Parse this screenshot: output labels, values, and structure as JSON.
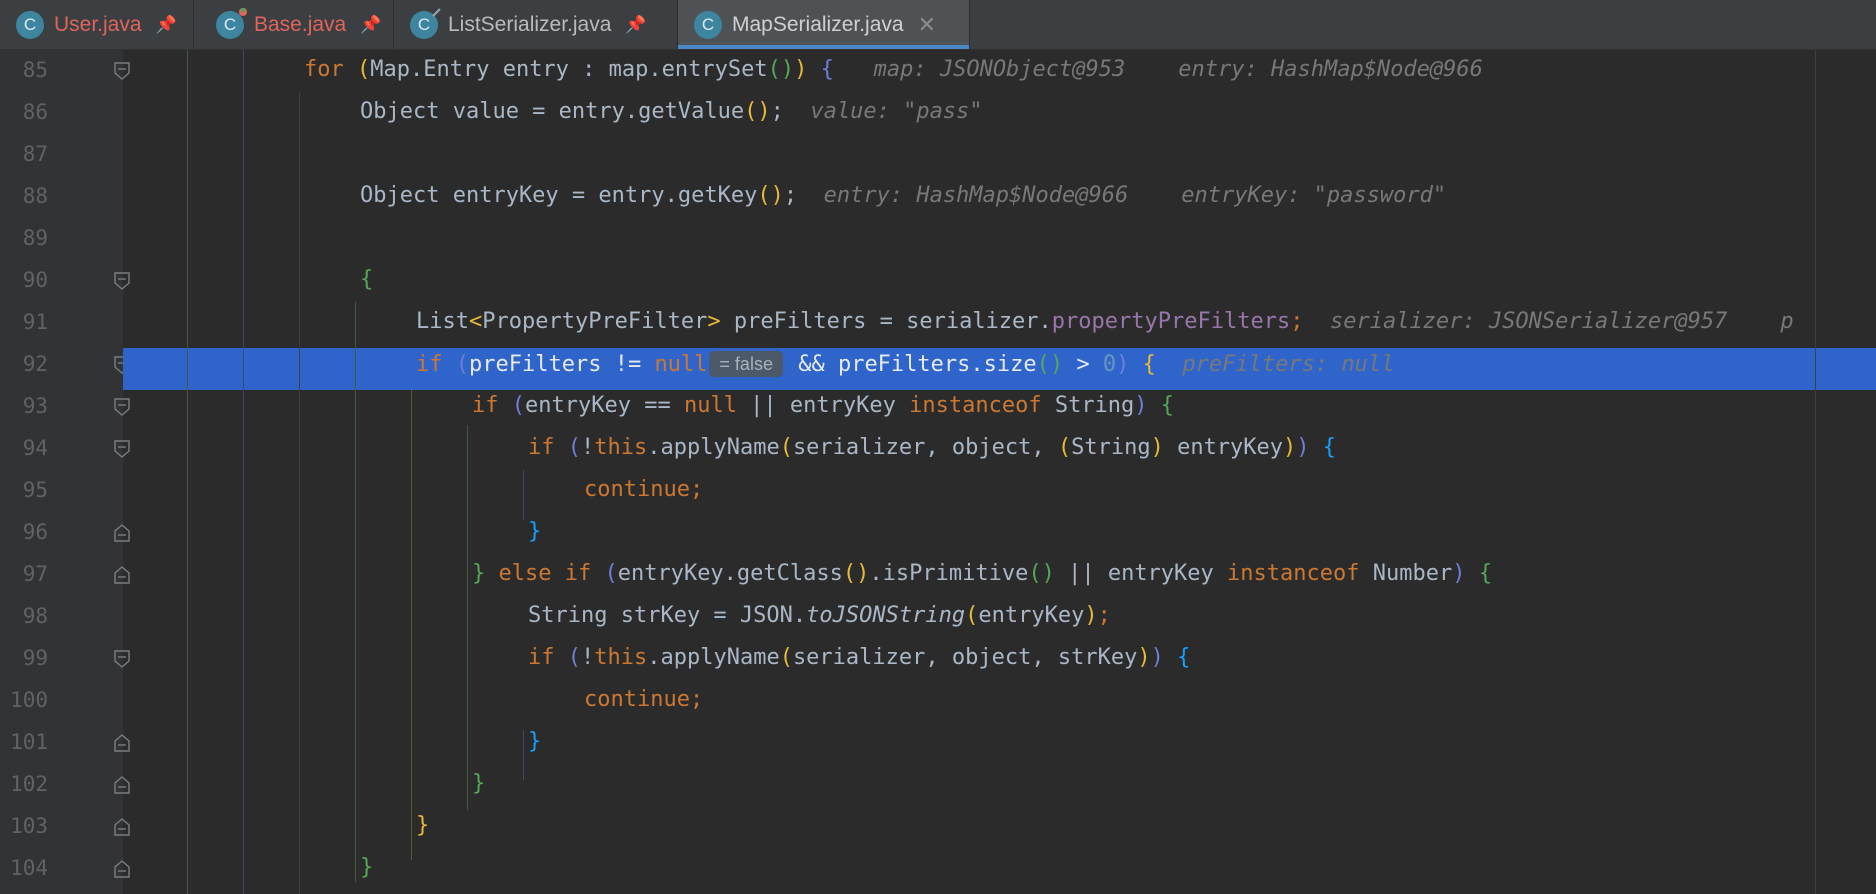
{
  "tabs": [
    {
      "name": "User.java",
      "pin": "📌"
    },
    {
      "name": "Base.java",
      "pin": "📌"
    },
    {
      "name": "ListSerializer.java",
      "pin": "📌"
    },
    {
      "name": "MapSerializer.java",
      "close": "✕"
    }
  ],
  "file_icon_letter": "C",
  "colors": {
    "tab_error_text": "#e0645b",
    "tab_text": "#bbbbbb",
    "active_tab_accent": "#4a88c7",
    "execution_line": "#2f65ca",
    "background": "#2b2b2b",
    "gutter": "#313335"
  },
  "editor": {
    "execution_line": "92",
    "lines": [
      {
        "n": "85",
        "t": {
          "kw1": "for",
          "a": "Map.Entry entry : map.entrySet",
          "hint1": "map: JSONObject@953",
          "hint2": "entry: HashMap$Node@966"
        }
      },
      {
        "n": "86",
        "t": {
          "a": "Object value = entry.getValue",
          "hint1": "value: \"pass\""
        }
      },
      {
        "n": "87",
        "t": {}
      },
      {
        "n": "88",
        "t": {
          "a": "Object entryKey = entry.getKey",
          "hint1": "entry: HashMap$Node@966",
          "hint2": "entryKey: \"password\""
        }
      },
      {
        "n": "89",
        "t": {}
      },
      {
        "n": "90",
        "t": {}
      },
      {
        "n": "91",
        "t": {
          "a": "List",
          "b": "PropertyPreFilter",
          "c": " preFilters = serializer.",
          "fld": "propertyPreFilters",
          "hint1": "serializer: JSONSerializer@957",
          "hint2": "p"
        }
      },
      {
        "n": "92",
        "t": {
          "kw1": "if",
          "a": "preFilters != ",
          "kw2": "null",
          "inline": "= false",
          "b": " && preFilters.size",
          "c": " > ",
          "num": "0",
          "hint1": "preFilters: null"
        }
      },
      {
        "n": "93",
        "t": {
          "kw1": "if",
          "a": "entryKey == ",
          "kw2": "null",
          "b": " || entryKey ",
          "kw3": "instanceof",
          "c": " String"
        }
      },
      {
        "n": "94",
        "t": {
          "kw1": "if",
          "a": "!",
          "kw2": "this",
          "b": ".applyName",
          "c": "serializer, object, ",
          "d": "String",
          "e": " entryKey"
        }
      },
      {
        "n": "95",
        "t": {
          "kw1": "continue;"
        }
      },
      {
        "n": "96",
        "t": {}
      },
      {
        "n": "97",
        "t": {
          "kw1": "else if",
          "a": "entryKey.getClass",
          "b": ".isPrimitive",
          "c": " || entryKey ",
          "kw2": "instanceof",
          "d": " Number"
        }
      },
      {
        "n": "98",
        "t": {
          "a": "String strKey = JSON.",
          "it": "toJSONString",
          "b": "entryKey"
        }
      },
      {
        "n": "99",
        "t": {
          "kw1": "if",
          "a": "!",
          "kw2": "this",
          "b": ".applyName",
          "c": "serializer, object, strKey"
        }
      },
      {
        "n": "100",
        "t": {
          "kw1": "continue;"
        }
      },
      {
        "n": "101",
        "t": {}
      },
      {
        "n": "102",
        "t": {}
      },
      {
        "n": "103",
        "t": {}
      },
      {
        "n": "104",
        "t": {}
      }
    ]
  }
}
